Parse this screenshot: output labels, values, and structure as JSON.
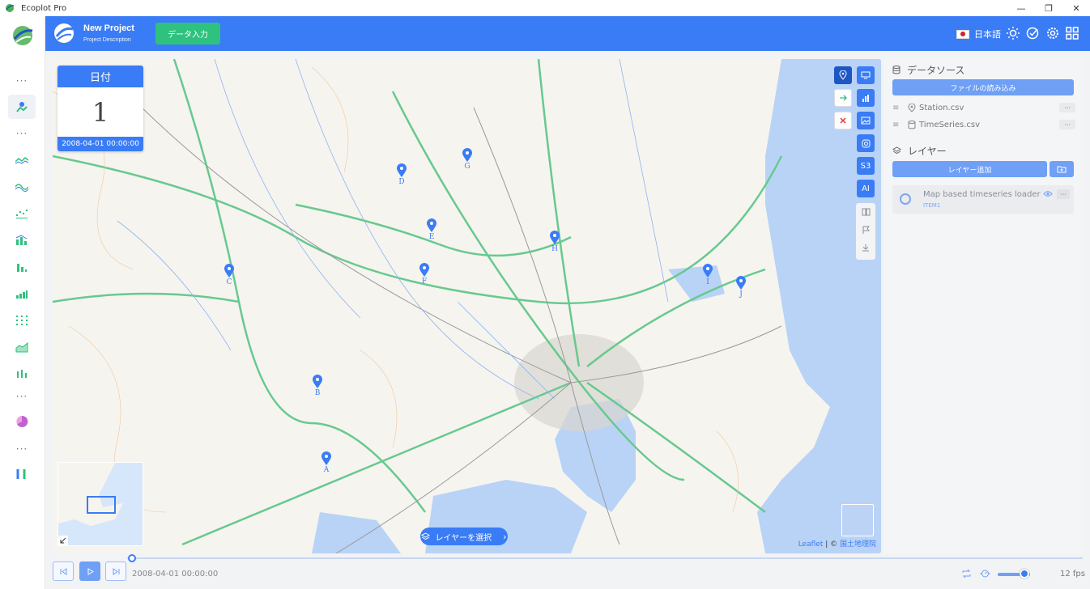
{
  "window": {
    "title": "Ecoplot Pro",
    "controls": [
      "—",
      "❐",
      "✕"
    ]
  },
  "header": {
    "project_title": "New Project",
    "project_description": "Project Description",
    "data_input_button": "データ入力",
    "language": "日本語",
    "icons": [
      "sun-icon",
      "check-circle-icon",
      "gear-icon",
      "grid-icon"
    ],
    "accent_color": "#3a7cf5"
  },
  "sidebar": {
    "items": [
      {
        "name": "more-dots",
        "label": "···"
      },
      {
        "name": "map-station-icon",
        "active": true
      },
      {
        "name": "more-dots",
        "label": "···"
      },
      {
        "name": "line-chart-icon"
      },
      {
        "name": "wave-chart-icon"
      },
      {
        "name": "dot-chart-icon"
      },
      {
        "name": "bar-chart-icon"
      },
      {
        "name": "column-chart-icon"
      },
      {
        "name": "stacked-chart-icon"
      },
      {
        "name": "scatter-grid-icon"
      },
      {
        "name": "area-chart-icon"
      },
      {
        "name": "dot-plot-icon"
      },
      {
        "name": "more-dots",
        "label": "···"
      },
      {
        "name": "pie-chart-icon"
      },
      {
        "name": "more-dots",
        "label": "···"
      },
      {
        "name": "tools-icon"
      }
    ]
  },
  "map": {
    "date_card": {
      "title": "日付",
      "number": "1",
      "datetime": "2008-04-01 00:00:00"
    },
    "markers": [
      "A",
      "B",
      "C",
      "D",
      "E",
      "F",
      "G",
      "H",
      "I",
      "J"
    ],
    "layer_select_label": "レイヤーを選択",
    "attribution_leaflet": "Leaflet",
    "attribution_sep": " | © ",
    "attribution_source": "国土地理院",
    "tools": {
      "col1": [
        "location-pin-icon",
        "arrow-right-icon",
        "close-icon"
      ],
      "col2": [
        "monitor-icon",
        "bar-chart-icon",
        "image-icon",
        "instagram-icon",
        "S3",
        "AI",
        "book-icon",
        "flag-icon",
        "download-icon"
      ]
    }
  },
  "right_panel": {
    "datasource_title": "データソース",
    "load_file_button": "ファイルの読み込み",
    "files": [
      {
        "name": "Station.csv",
        "icon": "location-pin-icon"
      },
      {
        "name": "TimeSeries.csv",
        "icon": "database-icon"
      }
    ],
    "layer_title": "レイヤー",
    "add_layer_button": "レイヤー追加",
    "layers": [
      {
        "name": "Map based timeseries loader",
        "sub": "ITEM1"
      }
    ]
  },
  "playback": {
    "time": "2008-04-01 00:00:00",
    "fps": "12 fps",
    "speed_fraction": 0.7
  }
}
